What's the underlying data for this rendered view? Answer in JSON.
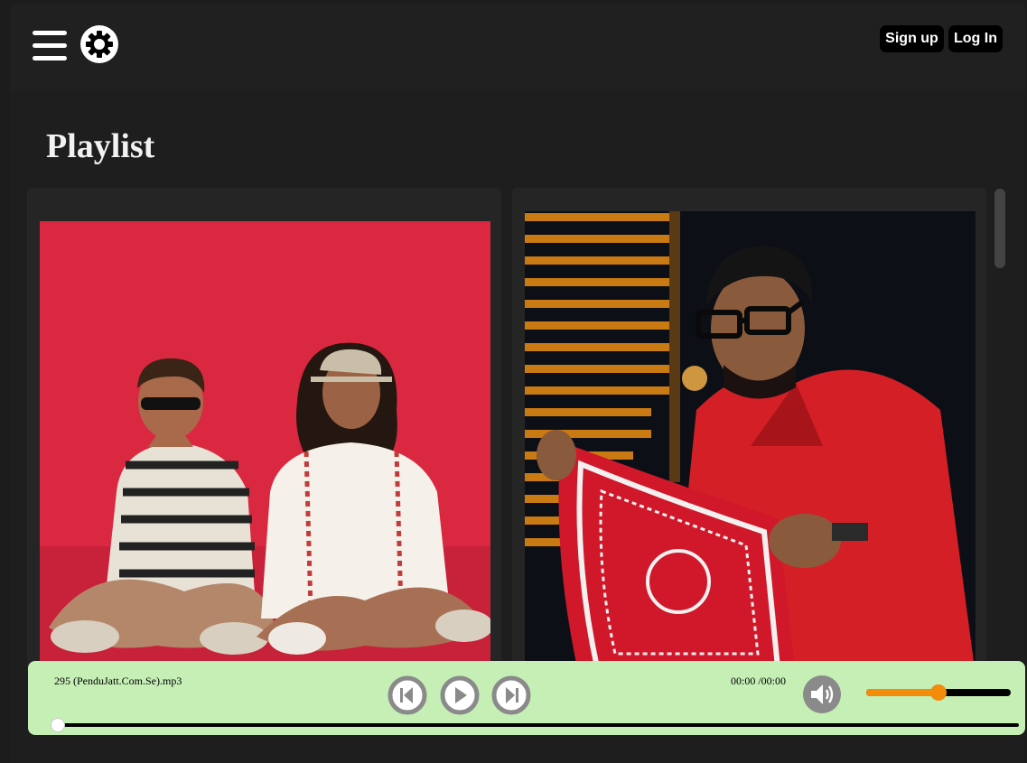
{
  "header": {
    "signup_label": "Sign up",
    "login_label": "Log In"
  },
  "main": {
    "title": "Playlist",
    "cards": [
      {
        "image": "artist-duo-red-background"
      },
      {
        "image": "artist-red-jacket-bandana"
      }
    ]
  },
  "player": {
    "track_name": "295 (PenduJatt.Com.Se).mp3",
    "time": "00:00 /00:00",
    "volume": 0.5,
    "progress": 0.0,
    "colors": {
      "player_bg": "#c6efb6",
      "volume_accent": "#f28c0a"
    }
  }
}
